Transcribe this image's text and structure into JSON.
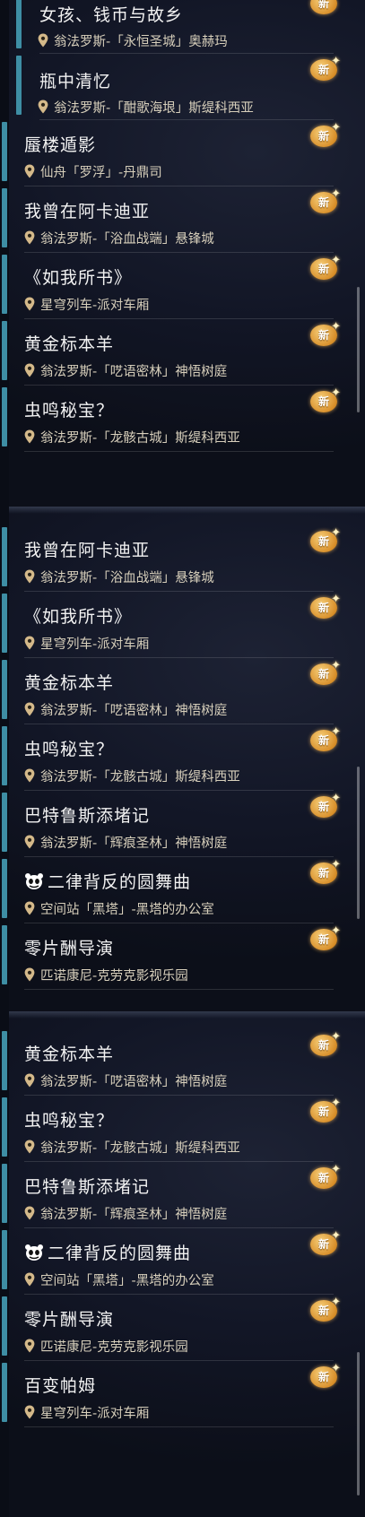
{
  "badge_text": "新",
  "sections": [
    {
      "items": [
        {
          "title": "女孩、钱币与故乡",
          "location": "翁法罗斯-「永恒圣城」奥赫玛",
          "new": true
        },
        {
          "title": "瓶中清忆",
          "location": "翁法罗斯-「酣歌海垠」斯缇科西亚",
          "new": true
        },
        {
          "title": "蜃楼遁影",
          "location": "仙舟「罗浮」-丹鼎司",
          "new": true
        },
        {
          "title": "我曾在阿卡迪亚",
          "location": "翁法罗斯-「浴血战端」悬锋城",
          "new": true
        },
        {
          "title": "《如我所书》",
          "location": "星穹列车-派对车厢",
          "new": true
        },
        {
          "title": "黄金标本羊",
          "location": "翁法罗斯-「呓语密林」神悟树庭",
          "new": true
        },
        {
          "title": "虫鸣秘宝？",
          "location": "翁法罗斯-「龙骸古城」斯缇科西亚",
          "new": true
        }
      ]
    },
    {
      "items": [
        {
          "title": "我曾在阿卡迪亚",
          "location": "翁法罗斯-「浴血战端」悬锋城",
          "new": true
        },
        {
          "title": "《如我所书》",
          "location": "星穹列车-派对车厢",
          "new": true
        },
        {
          "title": "黄金标本羊",
          "location": "翁法罗斯-「呓语密林」神悟树庭",
          "new": true
        },
        {
          "title": "虫鸣秘宝？",
          "location": "翁法罗斯-「龙骸古城」斯缇科西亚",
          "new": true
        },
        {
          "title": "巴特鲁斯添堵记",
          "location": "翁法罗斯-「辉痕圣林」神悟树庭",
          "new": true
        },
        {
          "title": "二律背反的圆舞曲",
          "location": "空间站「黑塔」-黑塔的办公室",
          "new": true,
          "icon": "panda-icon"
        },
        {
          "title": "零片酬导演",
          "location": "匹诺康尼-克劳克影视乐园",
          "new": true
        }
      ]
    },
    {
      "items": [
        {
          "title": "黄金标本羊",
          "location": "翁法罗斯-「呓语密林」神悟树庭",
          "new": true
        },
        {
          "title": "虫鸣秘宝？",
          "location": "翁法罗斯-「龙骸古城」斯缇科西亚",
          "new": true
        },
        {
          "title": "巴特鲁斯添堵记",
          "location": "翁法罗斯-「辉痕圣林」神悟树庭",
          "new": true
        },
        {
          "title": "二律背反的圆舞曲",
          "location": "空间站「黑塔」-黑塔的办公室",
          "new": true,
          "icon": "panda-icon"
        },
        {
          "title": "零片酬导演",
          "location": "匹诺康尼-克劳克影视乐园",
          "new": true
        },
        {
          "title": "百变帕姆",
          "location": "星穹列车-派对车厢",
          "new": true
        }
      ]
    }
  ],
  "colors": {
    "accent": "#3e8ea4",
    "location_text": "#d7cfbb",
    "badge": "#e0a040"
  }
}
